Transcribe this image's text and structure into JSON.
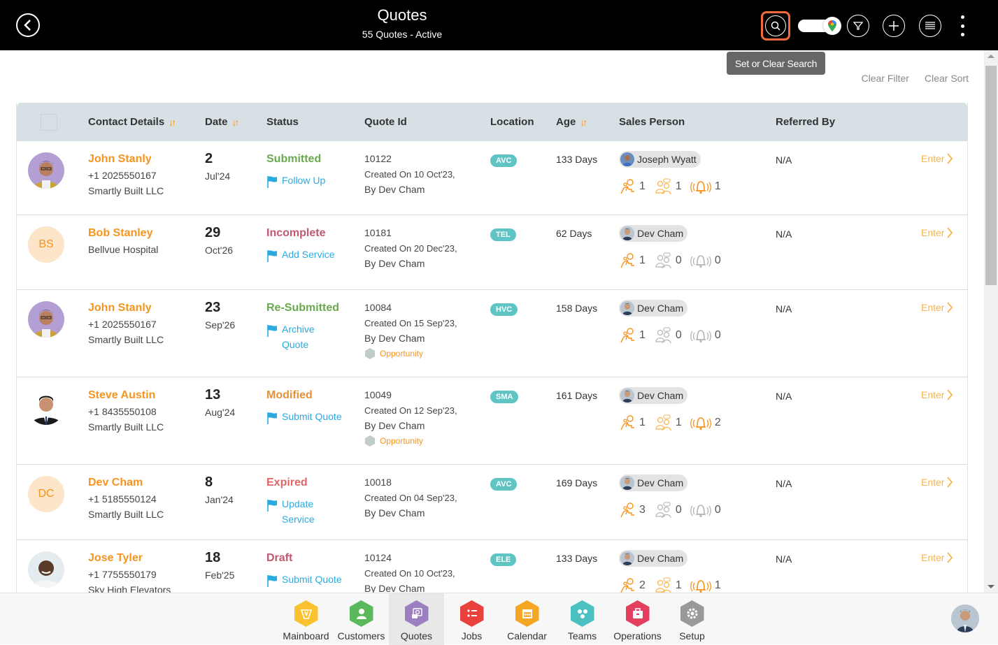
{
  "header": {
    "title": "Quotes",
    "subtitle": "55 Quotes - Active",
    "tooltip": "Set or Clear Search"
  },
  "links": {
    "clear_filter": "Clear Filter",
    "clear_sort": "Clear Sort"
  },
  "columns": [
    "Contact Details",
    "Date",
    "Status",
    "Quote Id",
    "Location",
    "Age",
    "Sales Person",
    "Referred By"
  ],
  "rows": [
    {
      "name": "John Stanly",
      "initials": "",
      "avatar": "photo-purple",
      "phone": "+1 2025550167",
      "company": "Smartly Built LLC",
      "day": "2",
      "month": "Jul'24",
      "status": "Submitted",
      "status_color": "#6aa84f",
      "action": "Follow Up",
      "quote_id": "10122",
      "created": "Created On 10 Oct'23,",
      "by": "By Dev Cham",
      "opportunity": "",
      "location": "AVC",
      "age": "133 Days",
      "sales_person": "Joseph Wyatt",
      "m1": "1",
      "m2": "1",
      "m3": "1",
      "m2_active": true,
      "m3_active": true,
      "referred": "N/A",
      "enter": "Enter"
    },
    {
      "name": "Bob Stanley",
      "initials": "BS",
      "avatar": "",
      "phone": "Bellvue Hospital",
      "company": "",
      "day": "29",
      "month": "Oct'26",
      "status": "Incomplete",
      "status_color": "#c2576e",
      "action": "Add Service",
      "quote_id": "10181",
      "created": "Created On 20 Dec'23,",
      "by": "By Dev Cham",
      "opportunity": "",
      "location": "TEL",
      "age": "62 Days",
      "sales_person": "Dev Cham",
      "m1": "1",
      "m2": "0",
      "m3": "0",
      "m2_active": false,
      "m3_active": false,
      "referred": "N/A",
      "enter": "Enter"
    },
    {
      "name": "John Stanly",
      "initials": "",
      "avatar": "photo-purple",
      "phone": "+1 2025550167",
      "company": "Smartly Built LLC",
      "day": "23",
      "month": "Sep'26",
      "status": "Re-Submitted",
      "status_color": "#6aa84f",
      "action": "Archive Quote",
      "quote_id": "10084",
      "created": "Created On 15 Sep'23,",
      "by": "By Dev Cham",
      "opportunity": "Opportunity",
      "location": "HVC",
      "age": "158 Days",
      "sales_person": "Dev Cham",
      "m1": "1",
      "m2": "0",
      "m3": "0",
      "m2_active": false,
      "m3_active": false,
      "referred": "N/A",
      "enter": "Enter"
    },
    {
      "name": "Steve Austin",
      "initials": "",
      "avatar": "photo-suit",
      "phone": "+1 8435550108",
      "company": "Smartly Built LLC",
      "day": "13",
      "month": "Aug'24",
      "status": "Modified",
      "status_color": "#e69138",
      "action": "Submit Quote",
      "quote_id": "10049",
      "created": "Created On 12 Sep'23,",
      "by": "By Dev Cham",
      "opportunity": "Opportunity",
      "location": "SMA",
      "age": "161 Days",
      "sales_person": "Dev Cham",
      "m1": "1",
      "m2": "1",
      "m3": "2",
      "m2_active": true,
      "m3_active": true,
      "referred": "N/A",
      "enter": "Enter"
    },
    {
      "name": "Dev Cham",
      "initials": "DC",
      "avatar": "",
      "phone": "+1 5185550124",
      "company": "Smartly Built LLC",
      "day": "8",
      "month": "Jan'24",
      "status": "Expired",
      "status_color": "#e06666",
      "action": "Update Service",
      "quote_id": "10018",
      "created": "Created On 04 Sep'23,",
      "by": "By Dev Cham",
      "opportunity": "",
      "location": "AVC",
      "age": "169 Days",
      "sales_person": "Dev Cham",
      "m1": "3",
      "m2": "0",
      "m3": "0",
      "m2_active": false,
      "m3_active": false,
      "referred": "N/A",
      "enter": "Enter"
    },
    {
      "name": "Jose Tyler",
      "initials": "",
      "avatar": "photo-white",
      "phone": "+1 7755550179",
      "company": "Sky High Elevators",
      "day": "18",
      "month": "Feb'25",
      "status": "Draft",
      "status_color": "#c2576e",
      "action": "Submit Quote",
      "quote_id": "10124",
      "created": "Created On 10 Oct'23,",
      "by": "By Dev Cham",
      "opportunity": "",
      "location": "ELE",
      "age": "133 Days",
      "sales_person": "Dev Cham",
      "m1": "2",
      "m2": "1",
      "m3": "1",
      "m2_active": true,
      "m3_active": true,
      "referred": "N/A",
      "enter": "Enter"
    }
  ],
  "nav": [
    {
      "label": "Mainboard",
      "color": "#f9c22e",
      "icon": "mainboard-icon"
    },
    {
      "label": "Customers",
      "color": "#5cb85c",
      "icon": "customers-icon"
    },
    {
      "label": "Quotes",
      "color": "#9b7fc0",
      "icon": "quotes-icon",
      "active": true
    },
    {
      "label": "Jobs",
      "color": "#e9413d",
      "icon": "jobs-icon"
    },
    {
      "label": "Calendar",
      "color": "#f5a623",
      "icon": "calendar-icon"
    },
    {
      "label": "Teams",
      "color": "#4bc0c0",
      "icon": "teams-icon"
    },
    {
      "label": "Operations",
      "color": "#e53f5f",
      "icon": "operations-icon"
    },
    {
      "label": "Setup",
      "color": "#999999",
      "icon": "setup-icon"
    }
  ],
  "colors": {
    "accent": "#f7941d",
    "link": "#29abe2",
    "header_bg": "#d6e0e5",
    "search_highlight": "#f26b3a"
  }
}
